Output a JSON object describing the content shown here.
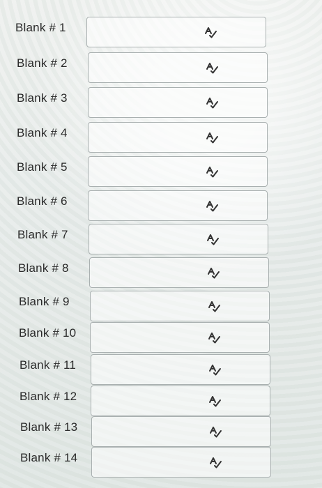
{
  "blanks": [
    {
      "label": "Blank # 1",
      "value": ""
    },
    {
      "label": "Blank # 2",
      "value": ""
    },
    {
      "label": "Blank # 3",
      "value": ""
    },
    {
      "label": "Blank # 4",
      "value": ""
    },
    {
      "label": "Blank # 5",
      "value": ""
    },
    {
      "label": "Blank # 6",
      "value": ""
    },
    {
      "label": "Blank # 7",
      "value": ""
    },
    {
      "label": "Blank # 8",
      "value": ""
    },
    {
      "label": "Blank # 9",
      "value": ""
    },
    {
      "label": "Blank # 10",
      "value": ""
    },
    {
      "label": "Blank # 11",
      "value": ""
    },
    {
      "label": "Blank # 12",
      "value": ""
    },
    {
      "label": "Blank # 13",
      "value": ""
    },
    {
      "label": "Blank # 14",
      "value": ""
    }
  ],
  "icons": {
    "spellcheck": "spellcheck-icon"
  },
  "colors": {
    "text": "#2a2a2a",
    "border": "#a9b0b0",
    "icon": "#333333"
  }
}
